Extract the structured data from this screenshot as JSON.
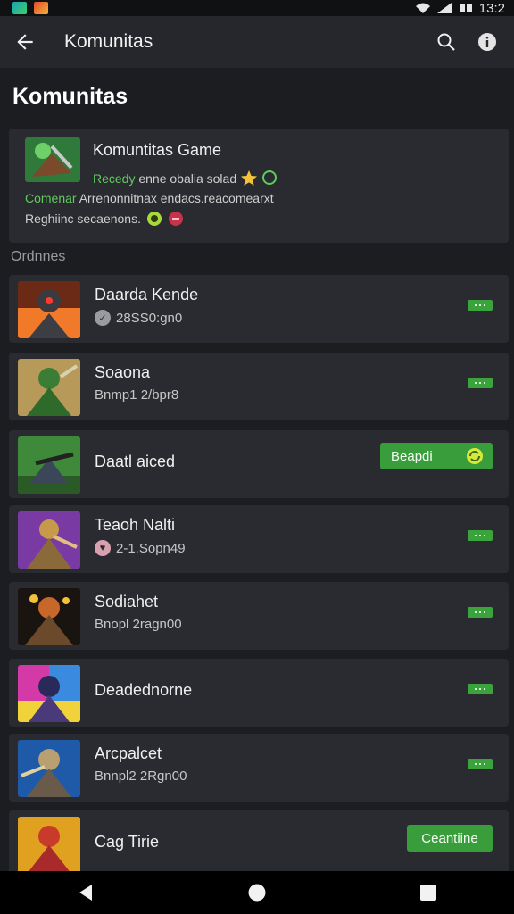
{
  "status_bar": {
    "time": "13:2"
  },
  "app_bar": {
    "title": "Komunitas"
  },
  "page": {
    "heading": "Komunitas"
  },
  "featured": {
    "title": "Komuntitas Game",
    "line1_green": "Recedy",
    "line1_text": "enne obalia solad",
    "line2_green": "Comenar",
    "line2_text": "Arrenonnitnax endacs.reacomearxt",
    "line3_text": "Reghiinc secaenons."
  },
  "section": {
    "label": "Ordnnes"
  },
  "items": [
    {
      "title": "Daarda Kende",
      "subtitle": "28SS0:gn0",
      "badge_icon": "check-icon",
      "button": "dots"
    },
    {
      "title": "Soaona",
      "subtitle": "Bnmp1 2/bpr8",
      "button": "dots"
    },
    {
      "title": "Daatl aiced",
      "button": "wide",
      "button_label": "Beapdi"
    },
    {
      "title": "Teaoh Nalti",
      "subtitle": "2-1.Sopn49",
      "badge_icon": "heart-icon",
      "button": "dots"
    },
    {
      "title": "Sodiahet",
      "subtitle": "Bnopl 2ragn00",
      "button": "dots"
    },
    {
      "title": "Deadednorne",
      "button": "dots"
    },
    {
      "title": "Arcpalcet",
      "subtitle": "Bnnpl2 2Rgn00",
      "button": "dots"
    },
    {
      "title": "Cag Tirie",
      "button": "wide",
      "button_label": "Ceantiine"
    }
  ],
  "colors": {
    "accent_green": "#3aa33b",
    "card_bg": "#2a2b30",
    "page_bg": "#1c1d21"
  }
}
